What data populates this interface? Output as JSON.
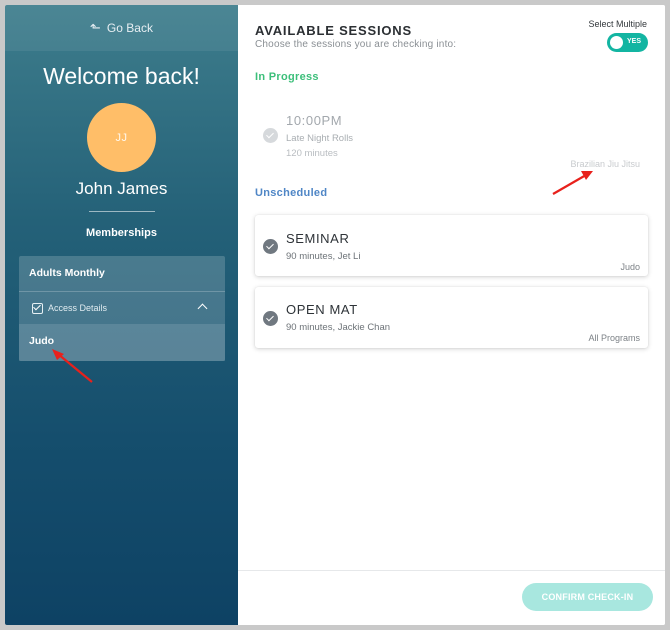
{
  "sidebar": {
    "go_back_label": "Go Back",
    "welcome": "Welcome back!",
    "avatar_initials": "JJ",
    "user_name": "John James",
    "memberships_heading": "Memberships",
    "membership": {
      "name": "Adults Monthly",
      "access_label": "Access Details",
      "programs": [
        "Judo"
      ]
    }
  },
  "main": {
    "title": "AVAILABLE SESSIONS",
    "subtitle": "Choose the sessions you are checking into:",
    "select_multiple_label": "Select Multiple",
    "toggle_text": "YES",
    "in_progress_label": "In Progress",
    "unscheduled_label": "Unscheduled",
    "in_progress_sessions": [
      {
        "title": "10:00PM",
        "subtitle": "Late Night Rolls",
        "duration": "120 minutes",
        "program": "Brazilian Jiu Jitsu"
      }
    ],
    "unscheduled_sessions": [
      {
        "title": "SEMINAR",
        "subtitle": "90 minutes, Jet Li",
        "program": "Judo"
      },
      {
        "title": "OPEN MAT",
        "subtitle": "90 minutes, Jackie Chan",
        "program": "All Programs"
      }
    ],
    "confirm_label": "CONFIRM CHECK-IN"
  },
  "colors": {
    "accent_teal": "#13b5a2",
    "in_progress_green": "#3cbf7a",
    "unscheduled_blue": "#4f86c6",
    "avatar_orange": "#ffbe68",
    "annotation_red": "#e8211c"
  }
}
